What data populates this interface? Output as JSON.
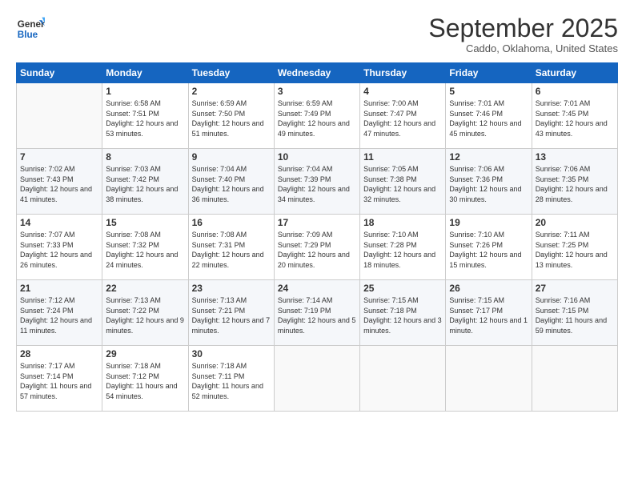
{
  "header": {
    "logo_line1": "General",
    "logo_line2": "Blue",
    "month": "September 2025",
    "location": "Caddo, Oklahoma, United States"
  },
  "weekdays": [
    "Sunday",
    "Monday",
    "Tuesday",
    "Wednesday",
    "Thursday",
    "Friday",
    "Saturday"
  ],
  "weeks": [
    [
      {
        "day": "",
        "sunrise": "",
        "sunset": "",
        "daylight": ""
      },
      {
        "day": "1",
        "sunrise": "Sunrise: 6:58 AM",
        "sunset": "Sunset: 7:51 PM",
        "daylight": "Daylight: 12 hours and 53 minutes."
      },
      {
        "day": "2",
        "sunrise": "Sunrise: 6:59 AM",
        "sunset": "Sunset: 7:50 PM",
        "daylight": "Daylight: 12 hours and 51 minutes."
      },
      {
        "day": "3",
        "sunrise": "Sunrise: 6:59 AM",
        "sunset": "Sunset: 7:49 PM",
        "daylight": "Daylight: 12 hours and 49 minutes."
      },
      {
        "day": "4",
        "sunrise": "Sunrise: 7:00 AM",
        "sunset": "Sunset: 7:47 PM",
        "daylight": "Daylight: 12 hours and 47 minutes."
      },
      {
        "day": "5",
        "sunrise": "Sunrise: 7:01 AM",
        "sunset": "Sunset: 7:46 PM",
        "daylight": "Daylight: 12 hours and 45 minutes."
      },
      {
        "day": "6",
        "sunrise": "Sunrise: 7:01 AM",
        "sunset": "Sunset: 7:45 PM",
        "daylight": "Daylight: 12 hours and 43 minutes."
      }
    ],
    [
      {
        "day": "7",
        "sunrise": "Sunrise: 7:02 AM",
        "sunset": "Sunset: 7:43 PM",
        "daylight": "Daylight: 12 hours and 41 minutes."
      },
      {
        "day": "8",
        "sunrise": "Sunrise: 7:03 AM",
        "sunset": "Sunset: 7:42 PM",
        "daylight": "Daylight: 12 hours and 38 minutes."
      },
      {
        "day": "9",
        "sunrise": "Sunrise: 7:04 AM",
        "sunset": "Sunset: 7:40 PM",
        "daylight": "Daylight: 12 hours and 36 minutes."
      },
      {
        "day": "10",
        "sunrise": "Sunrise: 7:04 AM",
        "sunset": "Sunset: 7:39 PM",
        "daylight": "Daylight: 12 hours and 34 minutes."
      },
      {
        "day": "11",
        "sunrise": "Sunrise: 7:05 AM",
        "sunset": "Sunset: 7:38 PM",
        "daylight": "Daylight: 12 hours and 32 minutes."
      },
      {
        "day": "12",
        "sunrise": "Sunrise: 7:06 AM",
        "sunset": "Sunset: 7:36 PM",
        "daylight": "Daylight: 12 hours and 30 minutes."
      },
      {
        "day": "13",
        "sunrise": "Sunrise: 7:06 AM",
        "sunset": "Sunset: 7:35 PM",
        "daylight": "Daylight: 12 hours and 28 minutes."
      }
    ],
    [
      {
        "day": "14",
        "sunrise": "Sunrise: 7:07 AM",
        "sunset": "Sunset: 7:33 PM",
        "daylight": "Daylight: 12 hours and 26 minutes."
      },
      {
        "day": "15",
        "sunrise": "Sunrise: 7:08 AM",
        "sunset": "Sunset: 7:32 PM",
        "daylight": "Daylight: 12 hours and 24 minutes."
      },
      {
        "day": "16",
        "sunrise": "Sunrise: 7:08 AM",
        "sunset": "Sunset: 7:31 PM",
        "daylight": "Daylight: 12 hours and 22 minutes."
      },
      {
        "day": "17",
        "sunrise": "Sunrise: 7:09 AM",
        "sunset": "Sunset: 7:29 PM",
        "daylight": "Daylight: 12 hours and 20 minutes."
      },
      {
        "day": "18",
        "sunrise": "Sunrise: 7:10 AM",
        "sunset": "Sunset: 7:28 PM",
        "daylight": "Daylight: 12 hours and 18 minutes."
      },
      {
        "day": "19",
        "sunrise": "Sunrise: 7:10 AM",
        "sunset": "Sunset: 7:26 PM",
        "daylight": "Daylight: 12 hours and 15 minutes."
      },
      {
        "day": "20",
        "sunrise": "Sunrise: 7:11 AM",
        "sunset": "Sunset: 7:25 PM",
        "daylight": "Daylight: 12 hours and 13 minutes."
      }
    ],
    [
      {
        "day": "21",
        "sunrise": "Sunrise: 7:12 AM",
        "sunset": "Sunset: 7:24 PM",
        "daylight": "Daylight: 12 hours and 11 minutes."
      },
      {
        "day": "22",
        "sunrise": "Sunrise: 7:13 AM",
        "sunset": "Sunset: 7:22 PM",
        "daylight": "Daylight: 12 hours and 9 minutes."
      },
      {
        "day": "23",
        "sunrise": "Sunrise: 7:13 AM",
        "sunset": "Sunset: 7:21 PM",
        "daylight": "Daylight: 12 hours and 7 minutes."
      },
      {
        "day": "24",
        "sunrise": "Sunrise: 7:14 AM",
        "sunset": "Sunset: 7:19 PM",
        "daylight": "Daylight: 12 hours and 5 minutes."
      },
      {
        "day": "25",
        "sunrise": "Sunrise: 7:15 AM",
        "sunset": "Sunset: 7:18 PM",
        "daylight": "Daylight: 12 hours and 3 minutes."
      },
      {
        "day": "26",
        "sunrise": "Sunrise: 7:15 AM",
        "sunset": "Sunset: 7:17 PM",
        "daylight": "Daylight: 12 hours and 1 minute."
      },
      {
        "day": "27",
        "sunrise": "Sunrise: 7:16 AM",
        "sunset": "Sunset: 7:15 PM",
        "daylight": "Daylight: 11 hours and 59 minutes."
      }
    ],
    [
      {
        "day": "28",
        "sunrise": "Sunrise: 7:17 AM",
        "sunset": "Sunset: 7:14 PM",
        "daylight": "Daylight: 11 hours and 57 minutes."
      },
      {
        "day": "29",
        "sunrise": "Sunrise: 7:18 AM",
        "sunset": "Sunset: 7:12 PM",
        "daylight": "Daylight: 11 hours and 54 minutes."
      },
      {
        "day": "30",
        "sunrise": "Sunrise: 7:18 AM",
        "sunset": "Sunset: 7:11 PM",
        "daylight": "Daylight: 11 hours and 52 minutes."
      },
      {
        "day": "",
        "sunrise": "",
        "sunset": "",
        "daylight": ""
      },
      {
        "day": "",
        "sunrise": "",
        "sunset": "",
        "daylight": ""
      },
      {
        "day": "",
        "sunrise": "",
        "sunset": "",
        "daylight": ""
      },
      {
        "day": "",
        "sunrise": "",
        "sunset": "",
        "daylight": ""
      }
    ]
  ]
}
